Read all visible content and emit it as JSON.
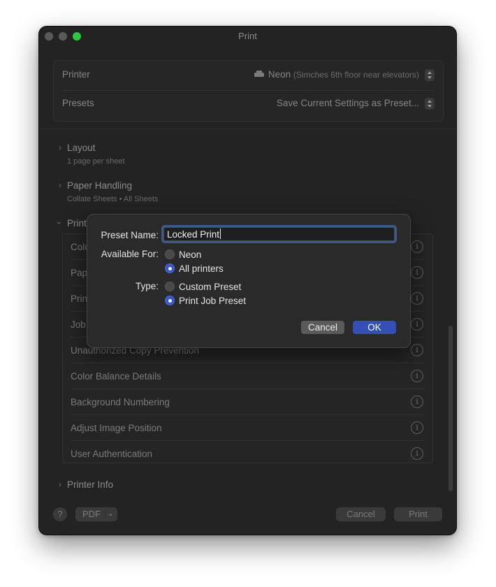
{
  "window": {
    "title": "Print",
    "traffic_lights": {
      "close": "#5a5a5a",
      "minimize": "#5a5a5a",
      "zoom": "#2bc840"
    }
  },
  "printer": {
    "label": "Printer",
    "name": "Neon",
    "location": "(Simches 6th floor near elevators)"
  },
  "presets": {
    "label": "Presets",
    "value": "Save Current Settings as Preset..."
  },
  "sections": {
    "layout": {
      "title": "Layout",
      "summary": "1 page per sheet"
    },
    "paper_handling": {
      "title": "Paper Handling",
      "summary": "Collate Sheets • All Sheets"
    },
    "printer_features": {
      "title_visible": "Print"
    },
    "printer_info": {
      "title": "Printer Info"
    }
  },
  "feature_rows": [
    {
      "label": "Colo"
    },
    {
      "label": "Pap"
    },
    {
      "label": "Prin"
    },
    {
      "label": "Job"
    },
    {
      "label": "Unauthorized Copy Prevention"
    },
    {
      "label": "Color Balance Details"
    },
    {
      "label": "Background Numbering"
    },
    {
      "label": "Adjust Image Position"
    },
    {
      "label": "User Authentication"
    }
  ],
  "footer": {
    "help": "?",
    "pdf": "PDF",
    "cancel": "Cancel",
    "print": "Print"
  },
  "dialog": {
    "preset_name_label": "Preset Name:",
    "preset_name_value": "Locked Print",
    "available_for_label": "Available For:",
    "available_for_options": [
      {
        "label": "Neon",
        "selected": false
      },
      {
        "label": "All printers",
        "selected": true
      }
    ],
    "type_label": "Type:",
    "type_options": [
      {
        "label": "Custom Preset",
        "selected": false
      },
      {
        "label": "Print Job Preset",
        "selected": true
      }
    ],
    "cancel": "Cancel",
    "ok": "OK",
    "accent": "#3450b8"
  }
}
